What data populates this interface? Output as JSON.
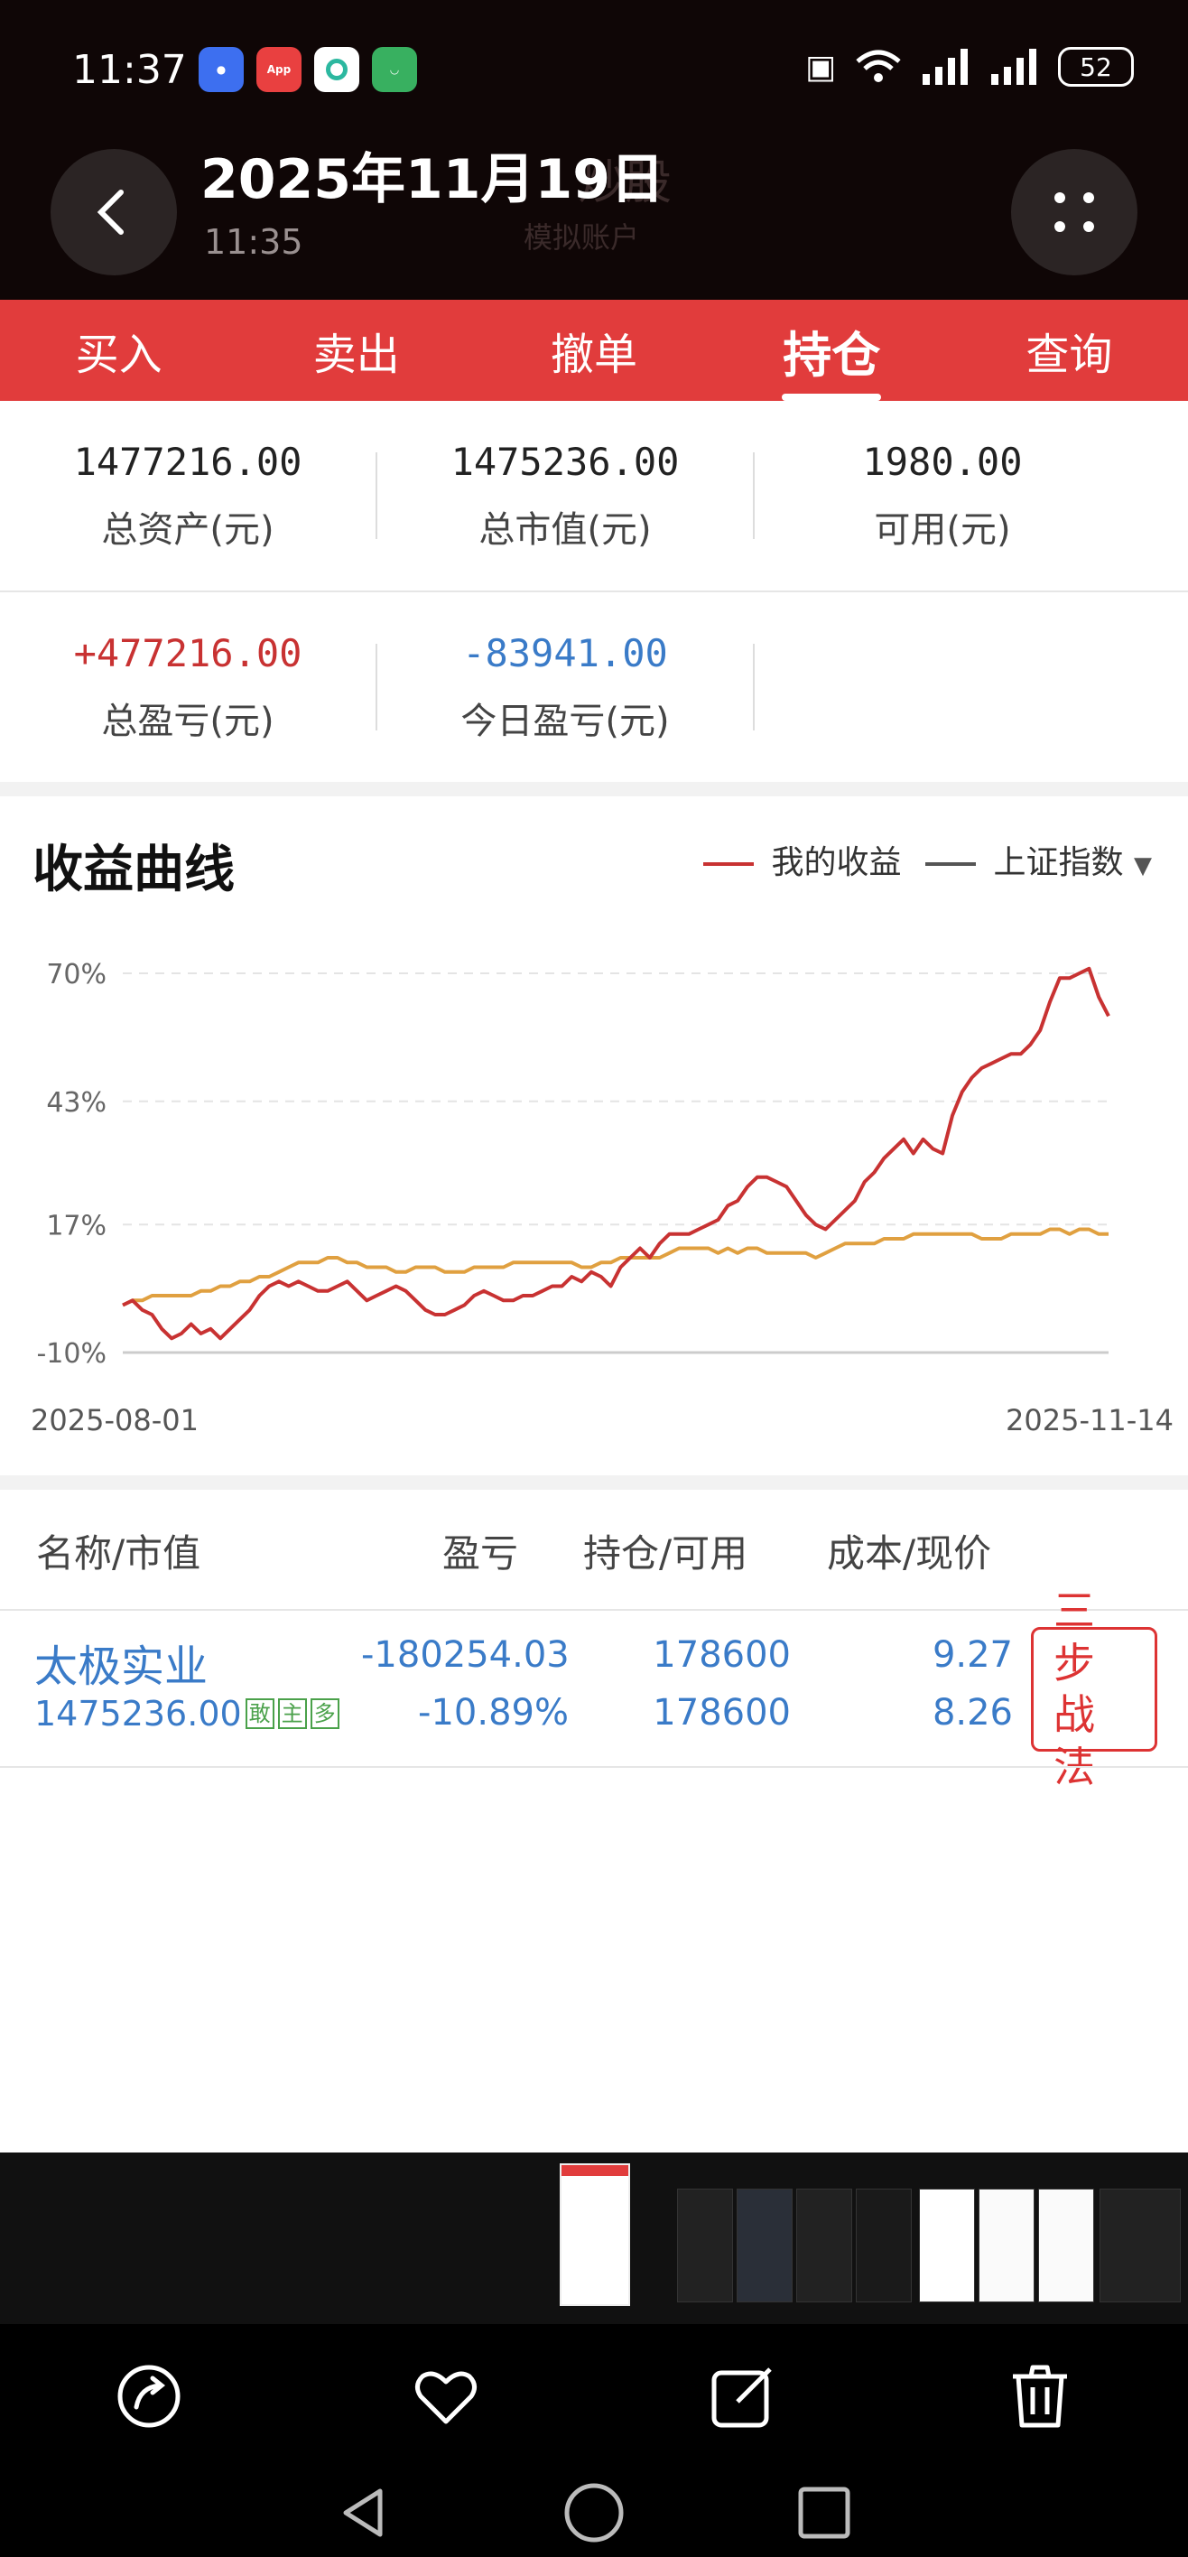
{
  "status": {
    "time": "11:37",
    "battery": "52"
  },
  "header": {
    "date_title": "2025年11月19日",
    "time": "11:35",
    "ghost_title": "炒股",
    "ghost_sub": "模拟账户"
  },
  "tabs": [
    "买入",
    "卖出",
    "撤单",
    "持仓",
    "查询"
  ],
  "active_tab": "持仓",
  "stats": {
    "total_assets": {
      "value": "1477216.00",
      "label": "总资产(元)"
    },
    "market_value": {
      "value": "1475236.00",
      "label": "总市值(元)"
    },
    "available": {
      "value": "1980.00",
      "label": "可用(元)"
    },
    "total_pnl": {
      "value": "+477216.00",
      "label": "总盈亏(元)"
    },
    "today_pnl": {
      "value": "-83941.00",
      "label": "今日盈亏(元)"
    }
  },
  "chart_title": "收益曲线",
  "legend": {
    "mine": "我的收益",
    "index": "上证指数"
  },
  "colors": {
    "red": "#c83232",
    "orange": "#e0a040",
    "blue": "#3a7bc8",
    "tab_red": "#e13c3c"
  },
  "chart_data": {
    "type": "line",
    "ylim": [
      -10,
      70
    ],
    "y_ticks": [
      "70%",
      "43%",
      "17%",
      "-10%"
    ],
    "x_tick_labels": [
      "2025-08-01",
      "2025-11-14"
    ],
    "series": [
      {
        "name": "我的收益",
        "color": "#c83232",
        "values": [
          0,
          1,
          -1,
          -2,
          -5,
          -7,
          -6,
          -4,
          -6,
          -5,
          -7,
          -5,
          -3,
          -1,
          2,
          4,
          5,
          4,
          5,
          4,
          3,
          3,
          4,
          5,
          3,
          1,
          2,
          3,
          4,
          3,
          1,
          -1,
          -2,
          -2,
          -1,
          0,
          2,
          3,
          2,
          1,
          1,
          2,
          2,
          3,
          4,
          4,
          6,
          5,
          7,
          6,
          4,
          8,
          10,
          12,
          10,
          13,
          15,
          15,
          15,
          16,
          17,
          18,
          21,
          22,
          25,
          27,
          27,
          26,
          25,
          22,
          19,
          17,
          16,
          18,
          20,
          22,
          26,
          28,
          31,
          33,
          35,
          32,
          35,
          33,
          32,
          40,
          45,
          48,
          50,
          51,
          52,
          53,
          53,
          55,
          58,
          64,
          69,
          69,
          70,
          71,
          65,
          61
        ]
      },
      {
        "name": "上证指数",
        "color": "#e0a040",
        "values": [
          0,
          1,
          1,
          2,
          2,
          2,
          2,
          2,
          3,
          3,
          4,
          4,
          5,
          5,
          6,
          6,
          7,
          8,
          9,
          9,
          9,
          10,
          10,
          9,
          9,
          8,
          8,
          8,
          7,
          7,
          8,
          8,
          8,
          7,
          7,
          7,
          8,
          8,
          8,
          8,
          9,
          9,
          9,
          9,
          9,
          9,
          9,
          8,
          8,
          9,
          9,
          10,
          10,
          10,
          10,
          10,
          11,
          12,
          12,
          12,
          12,
          11,
          12,
          11,
          12,
          12,
          11,
          11,
          11,
          11,
          11,
          10,
          11,
          12,
          13,
          13,
          13,
          13,
          14,
          14,
          14,
          15,
          15,
          15,
          15,
          15,
          15,
          15,
          14,
          14,
          14,
          15,
          15,
          15,
          15,
          16,
          16,
          15,
          16,
          16,
          15,
          15
        ]
      }
    ]
  },
  "holdings": {
    "headers": {
      "name": "名称/市值",
      "pnl": "盈亏",
      "pos": "持仓/可用",
      "cost": "成本/现价"
    },
    "rows": [
      {
        "name": "太极实业",
        "market_value": "1475236.00",
        "tags": [
          "敢",
          "主",
          "多"
        ],
        "pnl": "-180254.03",
        "pnl_pct": "-10.89%",
        "position": "178600",
        "available": "178600",
        "cost": "9.27",
        "price": "8.26",
        "action": "三步战法"
      }
    ]
  }
}
